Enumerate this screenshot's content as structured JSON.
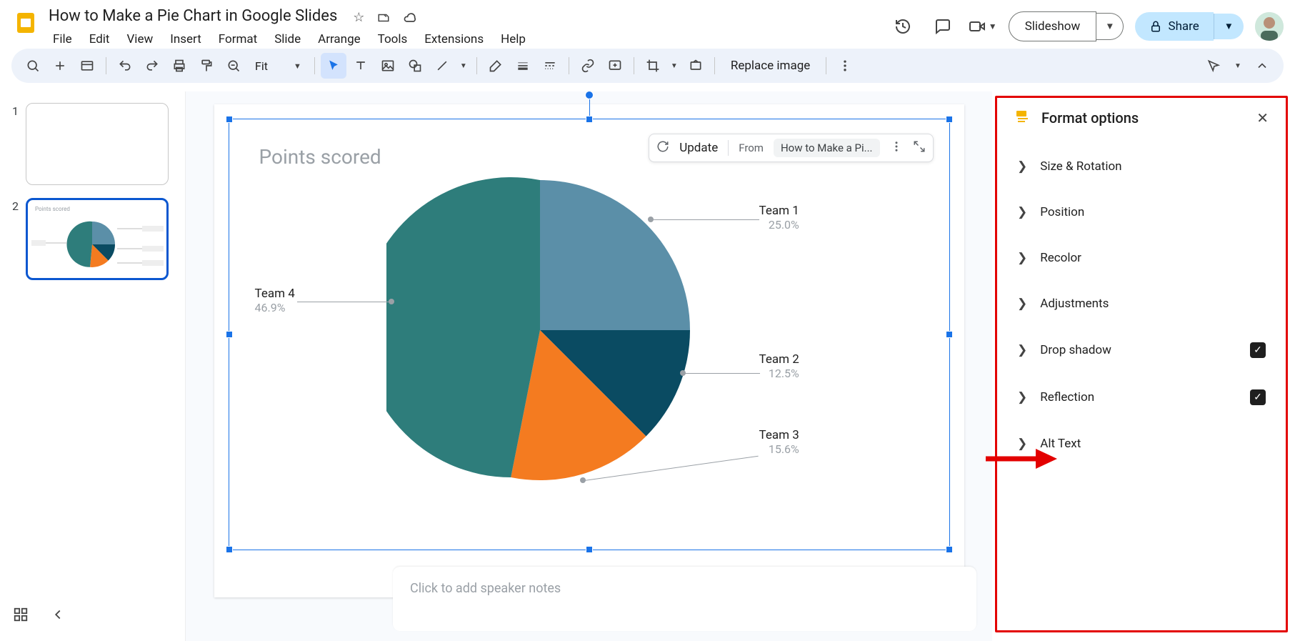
{
  "doc": {
    "title": "How to Make a Pie Chart in Google Slides"
  },
  "menu": {
    "file": "File",
    "edit": "Edit",
    "view": "View",
    "insert": "Insert",
    "format": "Format",
    "slide": "Slide",
    "arrange": "Arrange",
    "tools": "Tools",
    "extensions": "Extensions",
    "help": "Help"
  },
  "header_buttons": {
    "slideshow": "Slideshow",
    "share": "Share"
  },
  "toolbar": {
    "zoom": "Fit",
    "replace_image": "Replace image"
  },
  "filmstrip": {
    "s1": "1",
    "s2": "2"
  },
  "chart_toolbar": {
    "update": "Update",
    "from": "From",
    "source": "How to Make a Pi..."
  },
  "chart_data": {
    "type": "pie",
    "title": "Points scored",
    "series": [
      {
        "name": "Team 1",
        "value": 25.0,
        "label": "25.0%",
        "color": "#5b8fa8"
      },
      {
        "name": "Team 2",
        "value": 12.5,
        "label": "12.5%",
        "color": "#0a4b62"
      },
      {
        "name": "Team 3",
        "value": 15.6,
        "label": "15.6%",
        "color": "#f47b20"
      },
      {
        "name": "Team 4",
        "value": 46.9,
        "label": "46.9%",
        "color": "#2e7d7b"
      }
    ]
  },
  "speaker_notes": {
    "placeholder": "Click to add speaker notes"
  },
  "sidebar": {
    "title": "Format options",
    "items": {
      "size": "Size & Rotation",
      "position": "Position",
      "recolor": "Recolor",
      "adjustments": "Adjustments",
      "dropshadow": "Drop shadow",
      "reflection": "Reflection",
      "alttext": "Alt Text"
    }
  }
}
